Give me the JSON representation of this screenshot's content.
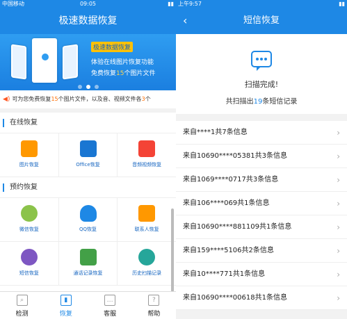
{
  "left": {
    "status": {
      "carrier": "中国移动",
      "time": "09:05"
    },
    "header_title": "极速数据恢复",
    "banner": {
      "tag": "极速数据恢复",
      "line1": "体验在线图片恢复功能",
      "line2_pre": "免费恢复",
      "line2_num": "15",
      "line2_post": "个图片文件"
    },
    "notice": {
      "pre": "可为您免费恢复",
      "num1": "15",
      "mid": "个图片文件，以及音、视频文件各",
      "num2": "3",
      "post": "个"
    },
    "section1": {
      "title": "在线恢复",
      "items": [
        {
          "label": "图片恢复",
          "color": "#ff9800"
        },
        {
          "label": "Office恢复",
          "color": "#1976d2"
        },
        {
          "label": "音频视频恢复",
          "color": "#f44336"
        }
      ]
    },
    "section2": {
      "title": "预约恢复",
      "items": [
        {
          "label": "微信恢复",
          "color": "#8bc34a"
        },
        {
          "label": "QQ恢复",
          "color": "#1e88e5"
        },
        {
          "label": "联系人恢复",
          "color": "#ff9800"
        }
      ]
    },
    "section3": {
      "items": [
        {
          "label": "短信恢复",
          "color": "#7e57c2"
        },
        {
          "label": "通话记录恢复",
          "color": "#43a047"
        },
        {
          "label": "历史扫描记录",
          "color": "#26a69a"
        }
      ]
    },
    "tabs": [
      {
        "label": "检测",
        "icon": "detect-icon"
      },
      {
        "label": "恢复",
        "icon": "restore-icon"
      },
      {
        "label": "客服",
        "icon": "service-icon"
      },
      {
        "label": "帮助",
        "icon": "help-icon"
      }
    ]
  },
  "right": {
    "status": {
      "time": "上午9:57"
    },
    "header_title": "短信恢复",
    "done_title": "扫描完成!",
    "done_summary": {
      "pre": "共扫描出",
      "num": "19",
      "post": "条短信记录"
    },
    "rows": [
      "来自****1共7条信息",
      "来自10690****05381共3条信息",
      "来自1069****0717共3条信息",
      "来自106****069共1条信息",
      "来自10690****881109共1条信息",
      "来自159****5106共2条信息",
      "来自10****771共1条信息",
      "来自10690****00618共1条信息"
    ]
  }
}
